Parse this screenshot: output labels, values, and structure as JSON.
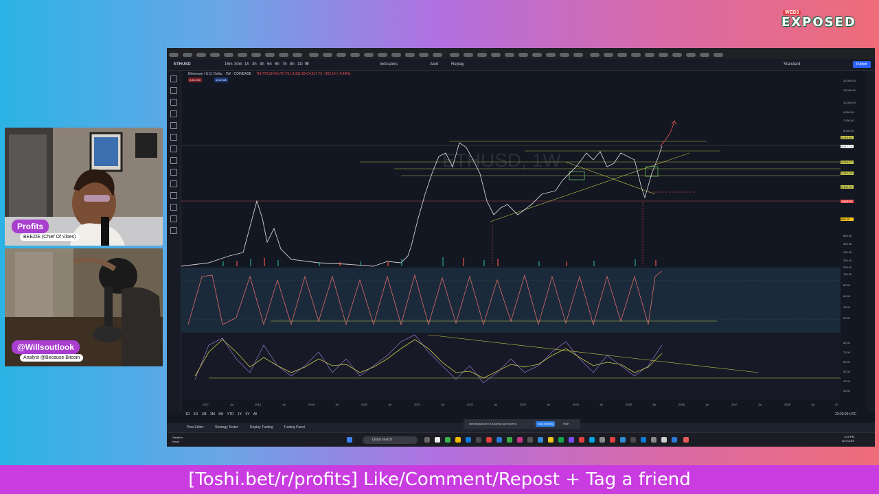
{
  "brand": {
    "logo_small": "WEB3",
    "logo_main": "EXPOSED"
  },
  "cams": {
    "host1_tag": "Profits",
    "host1_sub": "BEEZIE (Chief Of Vibes)",
    "host2_tag": "@Willsoutlook",
    "host2_sub": "Analyst @Because Bitcoin"
  },
  "toolbar": {
    "symbol": "ETHUSD",
    "intervals": [
      "15m",
      "30m",
      "1h",
      "3h",
      "4h",
      "5h",
      "6h",
      "7h",
      "8h",
      "1D",
      "W"
    ],
    "indicators": "Indicators",
    "alert": "Alert",
    "replay": "Replay",
    "layout": "Standard",
    "publish": "Publish"
  },
  "chart": {
    "legend": "Ethereum / U.S. Dollar · 1W · COINBASE",
    "ohlc": "O4,779.32 H4,797.70 L4,311.68 C4,517.73 −262.14 (−5.48%)",
    "sell": "4,317.59",
    "buy": "4,317.84",
    "watermark": "ETHUSD, 1W",
    "axis_labels": [
      "20,000.00",
      "15,000.00",
      "12,000.00",
      "9,500.00",
      "7,900.00",
      "6,300.00",
      "600.00",
      "500.00",
      "400.00",
      "300.00",
      "200.00"
    ],
    "price_tags": [
      "4,949.56",
      "4,517.73",
      "3,599.07",
      "3,341.18",
      "2,102.19",
      "1,523.79",
      "856.35"
    ],
    "osc1_ticks": [
      "100.00",
      "80.00",
      "60.00",
      "40.00",
      "20.00"
    ],
    "osc2_ticks": [
      "80.00",
      "70.00",
      "60.00",
      "50.00",
      "40.00",
      "30.00"
    ],
    "years": [
      "2017",
      "Jul",
      "2018",
      "Jul",
      "2019",
      "Jul",
      "2020",
      "Jul",
      "2021",
      "Jul",
      "2022",
      "Jul",
      "2023",
      "Jul",
      "2024",
      "Jul",
      "2025",
      "Jul",
      "2026",
      "Jul",
      "2027",
      "Jul",
      "2028",
      "Jul",
      "20"
    ],
    "timeframes": [
      "1D",
      "5D",
      "1M",
      "3M",
      "6M",
      "YTD",
      "1Y",
      "5Y",
      "All"
    ],
    "clock": "23:29:20 UTC"
  },
  "panels": {
    "pine": "Pine Editor",
    "strategy": "Strategy Tester",
    "replay": "Replay Trading",
    "trading": "Trading Panel"
  },
  "share": {
    "msg": "streamyard.com is sharing your screen.",
    "stop": "Stop sharing",
    "hide": "Hide"
  },
  "taskbar": {
    "search": "Quick search",
    "time": "4:29 PM",
    "date": "8/27/2025",
    "weather1": "Weather",
    "weather2": "News"
  },
  "banner": "[Toshi.bet/r/profits] Like/Comment/Repost + Tag a friend",
  "colors": {
    "bull": "#26a69a",
    "bear": "#ef5350",
    "level": "#c9c94a",
    "banner": "#c83ce0"
  }
}
